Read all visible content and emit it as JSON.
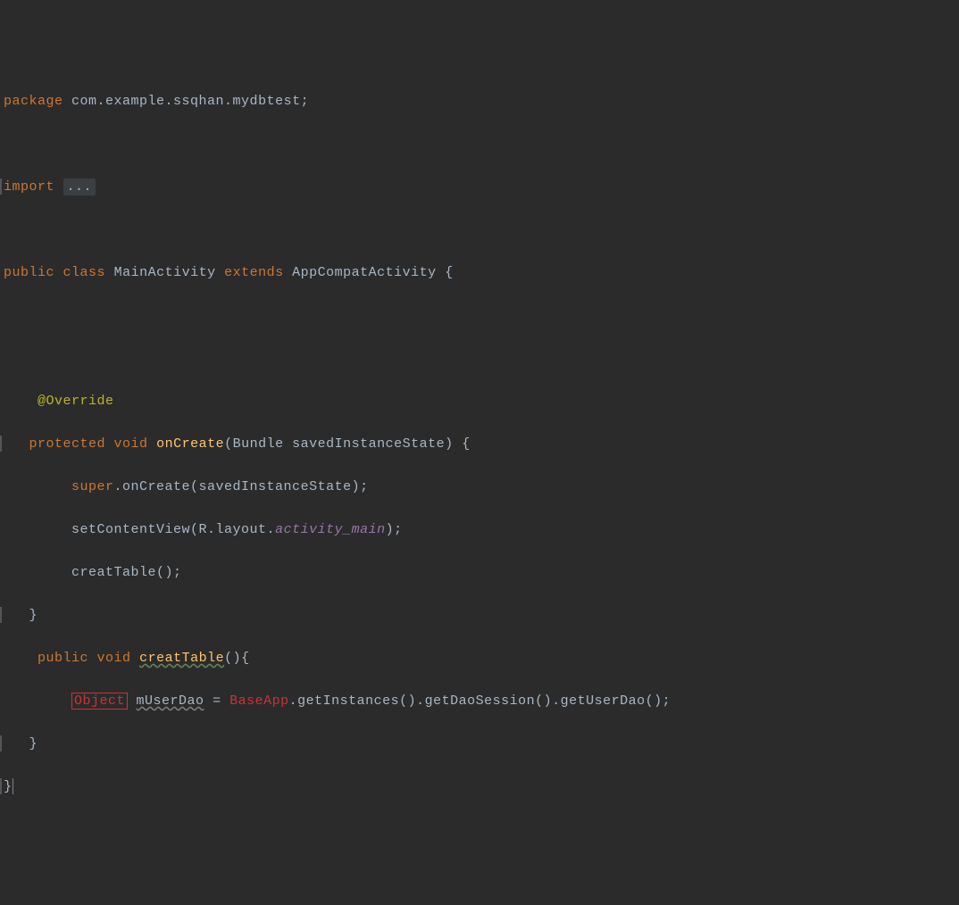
{
  "code": {
    "package_kw": "package",
    "package_path": "com.example.ssqhan.mydbtest",
    "import_kw": "import",
    "import_collapsed": "...",
    "public_kw": "public",
    "class_kw": "class",
    "class_name": "MainActivity",
    "extends_kw": "extends",
    "super_class": "AppCompatActivity",
    "open_brace": "{",
    "close_brace": "}",
    "override_ann": "@Override",
    "protected_kw": "protected",
    "void_kw": "void",
    "onCreate_name": "onCreate",
    "onCreate_params_open": "(",
    "onCreate_param_type": "Bundle",
    "onCreate_param_name": "savedInstanceState",
    "onCreate_params_close": ")",
    "super_kw": "super",
    "super_call": ".onCreate(savedInstanceState);",
    "setContentView": "setContentView(R.layout.",
    "activity_main": "activity_main",
    "setContentView_end": ");",
    "creatTable_call": "creatTable();",
    "creatTable_name": "creatTable",
    "creatTable_sig_end": "(){",
    "object_type": "Object",
    "mUserDao": "mUserDao",
    "eq": " = ",
    "baseapp": "BaseApp",
    "chain": ".getInstances().getDaoSession().getUserDao();"
  }
}
